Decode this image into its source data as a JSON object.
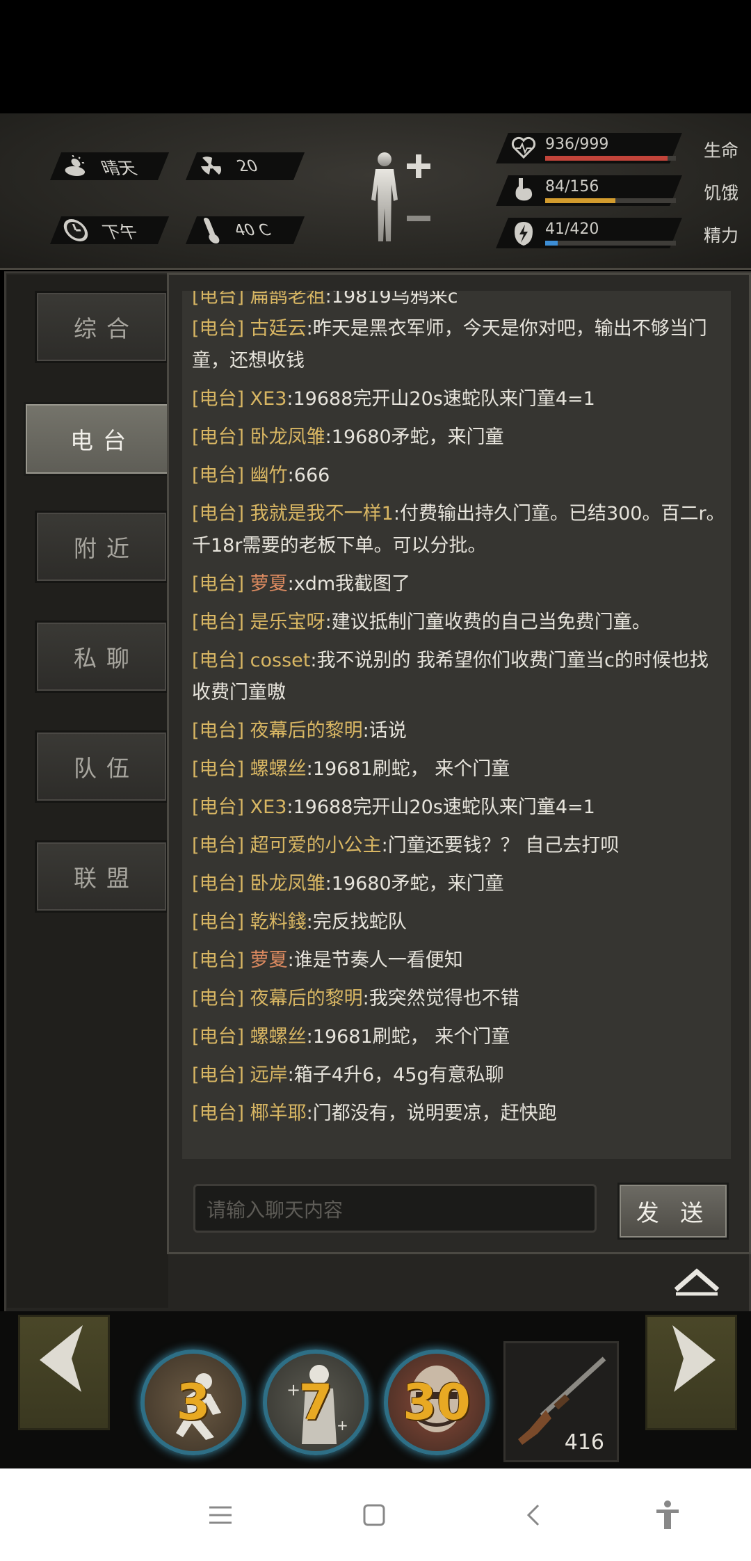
{
  "hud": {
    "weather": "晴天",
    "radiation": "20",
    "time_of_day": "下午",
    "temperature": "40 C",
    "stats": [
      {
        "key": "health",
        "value": "936/999",
        "label": "生命",
        "fraction": 0.937,
        "color": "#c2443a",
        "icon": "heart-icon"
      },
      {
        "key": "hunger",
        "value": "84/156",
        "label": "饥饿",
        "fraction": 0.538,
        "color": "#d39c2e",
        "icon": "stomach-icon"
      },
      {
        "key": "energy",
        "value": "41/420",
        "label": "精力",
        "fraction": 0.098,
        "color": "#3d8ed6",
        "icon": "lightning-icon"
      }
    ]
  },
  "tabs": [
    "综合",
    "电台",
    "附近",
    "私聊",
    "队伍",
    "联盟"
  ],
  "active_tab": "电台",
  "chat": {
    "tag": "[电台]",
    "partial_top": {
      "name": "扁鹊老祖",
      "text": ":19819乌鸦来c"
    },
    "messages": [
      {
        "name": "古廷云",
        "text": ":昨天是黑衣军师，今天是你对吧，输出不够当门童，还想收钱",
        "color": "gold"
      },
      {
        "name": "XE3",
        "text": ":19688完开山20s速蛇队来门童4=1",
        "color": "gold"
      },
      {
        "name": "卧龙凤雏",
        "text": ":19680矛蛇，来门童",
        "color": "gold"
      },
      {
        "name": "幽竹",
        "text": ":666",
        "color": "gold"
      },
      {
        "name": "我就是我不一样1",
        "text": ":付费输出持久门童。已结300。百二r。千18r需要的老板下单。可以分批。",
        "color": "gold"
      },
      {
        "name": "萝夏",
        "text": ":xdm我截图了",
        "color": "orange"
      },
      {
        "name": "是乐宝呀",
        "text": ":建议抵制门童收费的自己当免费门童。",
        "color": "gold"
      },
      {
        "name": "cosset",
        "text": ":我不说别的 我希望你们收费门童当c的时候也找收费门童嗷",
        "color": "gold"
      },
      {
        "name": "夜幕后的黎明",
        "text": ":话说",
        "color": "gold"
      },
      {
        "name": "螺螺丝",
        "text": ":19681刷蛇， 来个门童",
        "color": "gold"
      },
      {
        "name": "XE3",
        "text": ":19688完开山20s速蛇队来门童4=1",
        "color": "gold"
      },
      {
        "name": "超可爱的小公主",
        "text": ":门童还要钱？？ 自己去打呗",
        "color": "gold"
      },
      {
        "name": "卧龙凤雏",
        "text": ":19680矛蛇，来门童",
        "color": "gold"
      },
      {
        "name": "乾料錢",
        "text": ":完反找蛇队",
        "color": "gold"
      },
      {
        "name": "萝夏",
        "text": ":谁是节奏人一看便知",
        "color": "orange"
      },
      {
        "name": "夜幕后的黎明",
        "text": ":我突然觉得也不错",
        "color": "gold"
      },
      {
        "name": "螺螺丝",
        "text": ":19681刷蛇， 来个门童",
        "color": "gold"
      },
      {
        "name": "远岸",
        "text": ":箱子4升6，45g有意私聊",
        "color": "gold"
      },
      {
        "name": "椰羊耶",
        "text": ":门都没有，说明要凉，赶快跑",
        "color": "gold"
      }
    ],
    "input_placeholder": "请输入聊天内容",
    "send_label": "发 送"
  },
  "skills": [
    {
      "count": "3",
      "icon": "running-man-icon"
    },
    {
      "count": "7",
      "icon": "heal-figure-icon"
    },
    {
      "count": "30",
      "icon": "face-portrait-icon"
    }
  ],
  "weapon": {
    "count": "416",
    "icon": "shotgun-icon"
  }
}
